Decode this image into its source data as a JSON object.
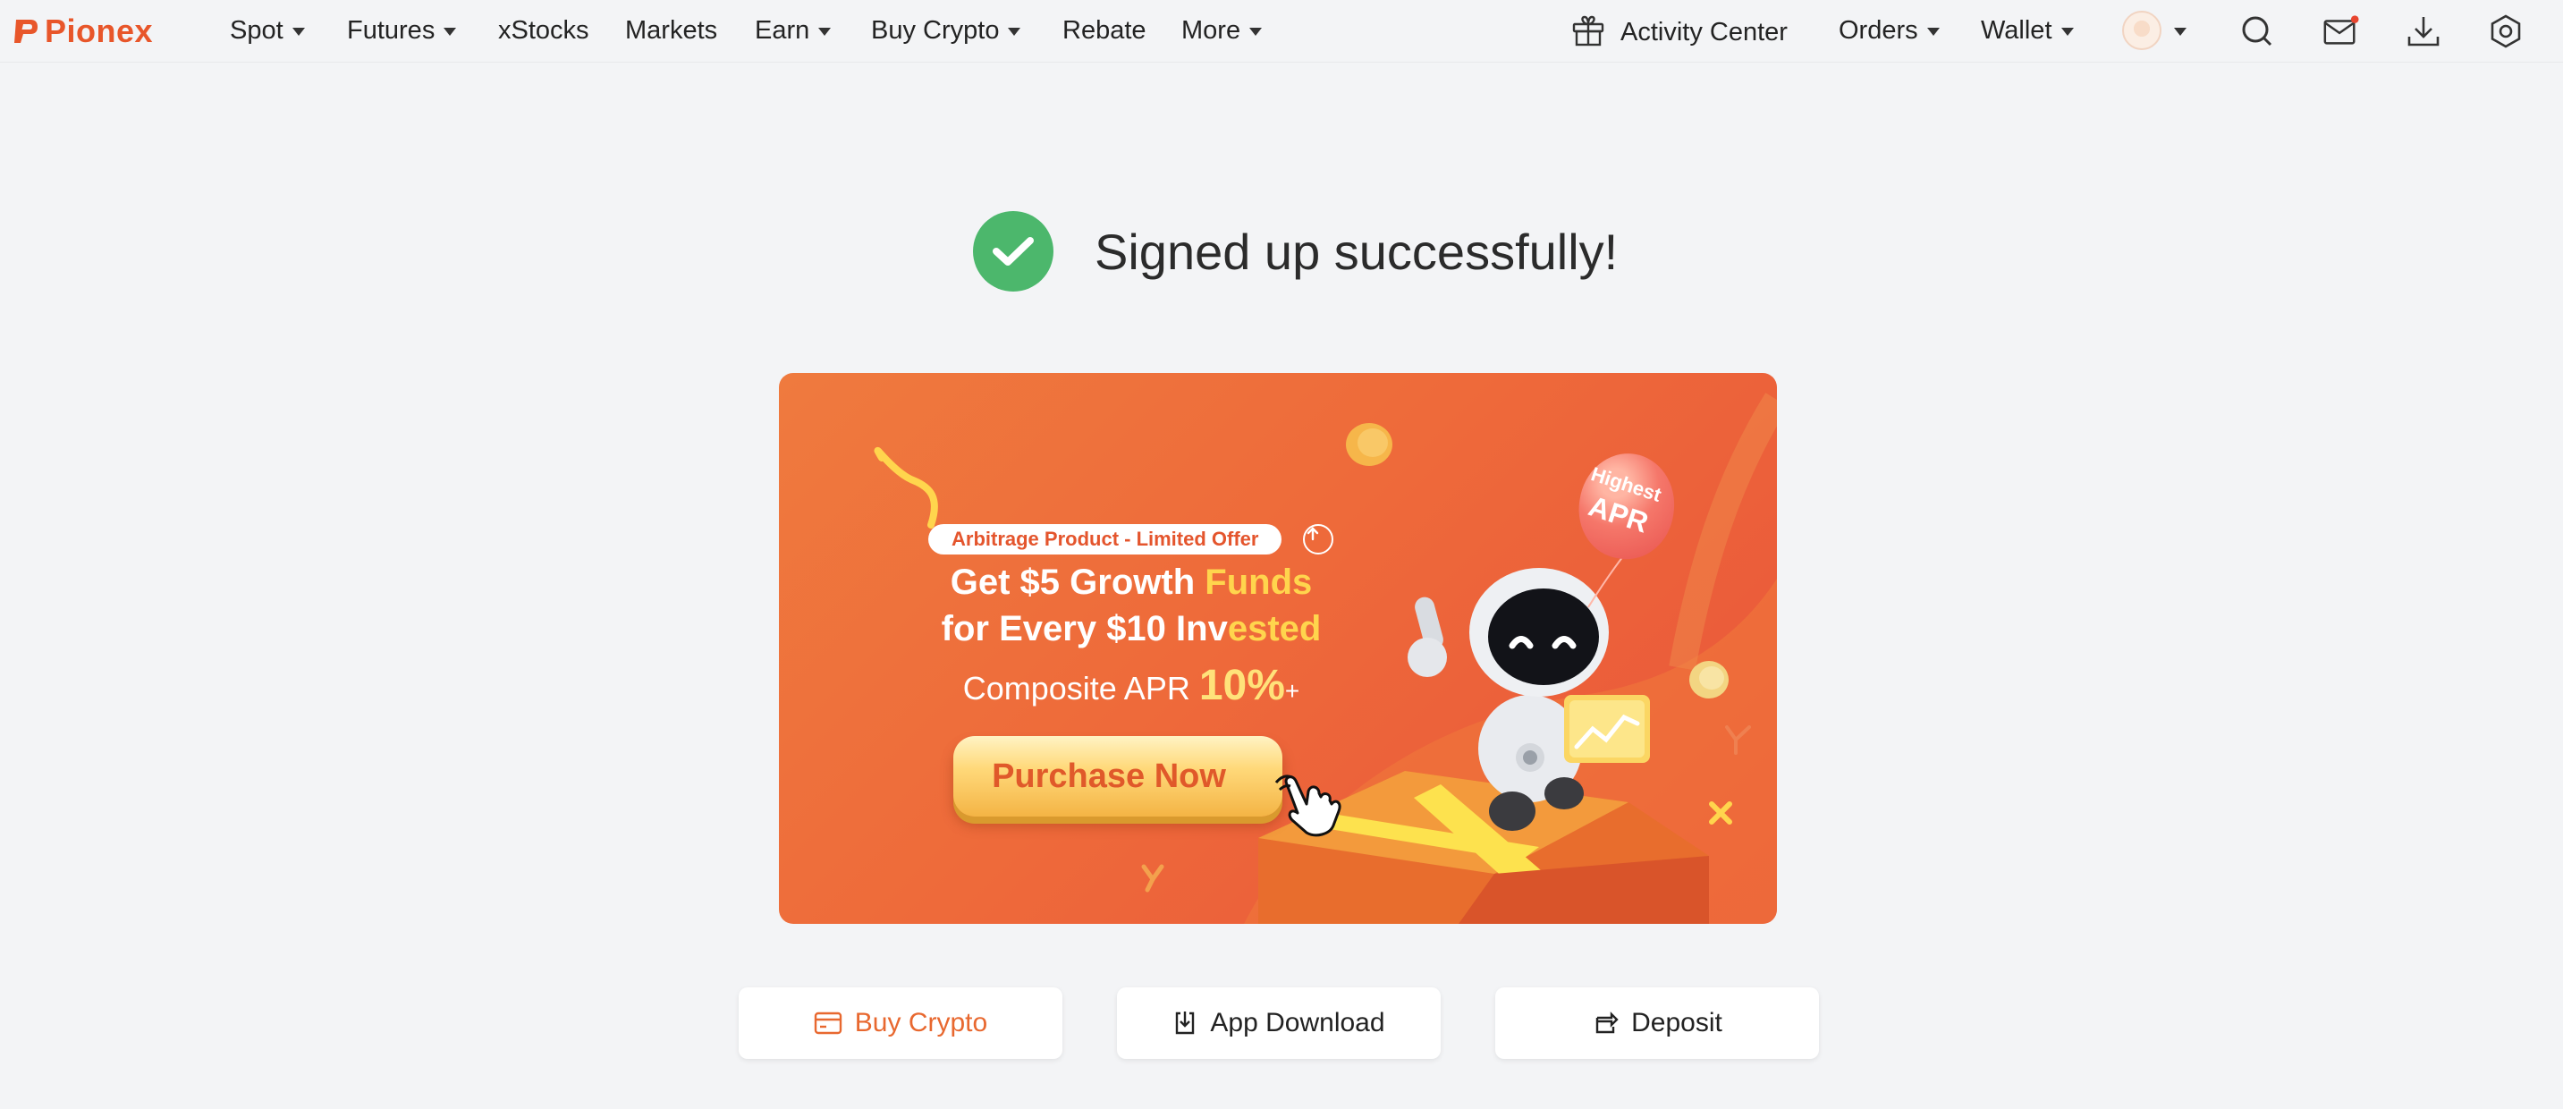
{
  "nav": {
    "brand": "Pionex",
    "items": [
      {
        "label": "Spot",
        "dropdown": true
      },
      {
        "label": "Futures",
        "dropdown": true
      },
      {
        "label": "xStocks",
        "dropdown": false
      },
      {
        "label": "Markets",
        "dropdown": false
      },
      {
        "label": "Earn",
        "dropdown": true
      },
      {
        "label": "Buy Crypto",
        "dropdown": true
      },
      {
        "label": "Rebate",
        "dropdown": false
      },
      {
        "label": "More",
        "dropdown": true
      }
    ],
    "activity_center": "Activity Center",
    "orders": "Orders",
    "wallet": "Wallet",
    "icons": [
      "gift-icon",
      "avatar",
      "search-icon",
      "mail-icon",
      "download-icon",
      "settings-icon"
    ],
    "mail_has_notification": true
  },
  "status": {
    "message": "Signed up successfully!",
    "icon": "check-circle-icon"
  },
  "banner": {
    "tag": "Arbitrage Product - Limited Offer",
    "headline_line1_white": "Get $5 Growth",
    "headline_line1_accent": "Funds",
    "headline_line2_white": "for Every $10 Inv",
    "headline_line2_accent": "ested",
    "apr_prefix": "Composite APR",
    "apr_value": "10%",
    "apr_suffix": "+",
    "cta": "Purchase Now",
    "balloon_line1": "Highest",
    "balloon_line2": "APR"
  },
  "actions": [
    {
      "label": "Buy Crypto",
      "icon": "card-icon"
    },
    {
      "label": "App Download",
      "icon": "app-download-icon"
    },
    {
      "label": "Deposit",
      "icon": "deposit-icon"
    }
  ],
  "colors": {
    "brand": "#e8562a",
    "success": "#4cb76c",
    "background": "#f3f4f6",
    "banner_accent": "#ffd54d",
    "notification_dot": "#e8452f"
  }
}
